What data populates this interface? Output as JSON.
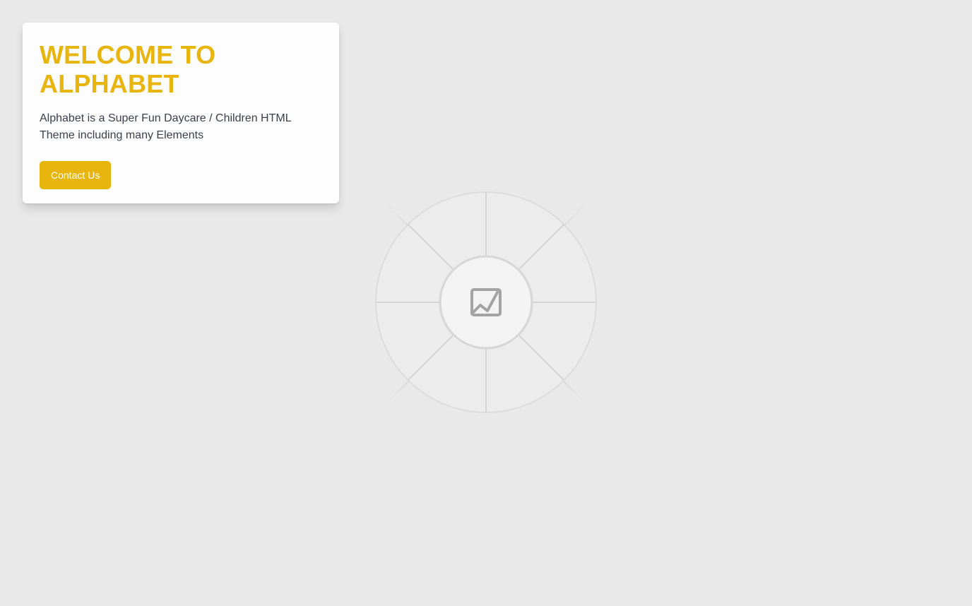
{
  "hero": {
    "title": "WELCOME TO ALPHABET",
    "description": "Alphabet is a Super Fun Daycare / Children HTML Theme including many Elements",
    "cta_label": "Contact Us"
  },
  "placeholder": {
    "icon": "image-placeholder-icon"
  },
  "colors": {
    "accent": "#e8b40e",
    "background": "#e9e9e9",
    "card": "#fdfdfd",
    "text": "#3a3f4b"
  }
}
